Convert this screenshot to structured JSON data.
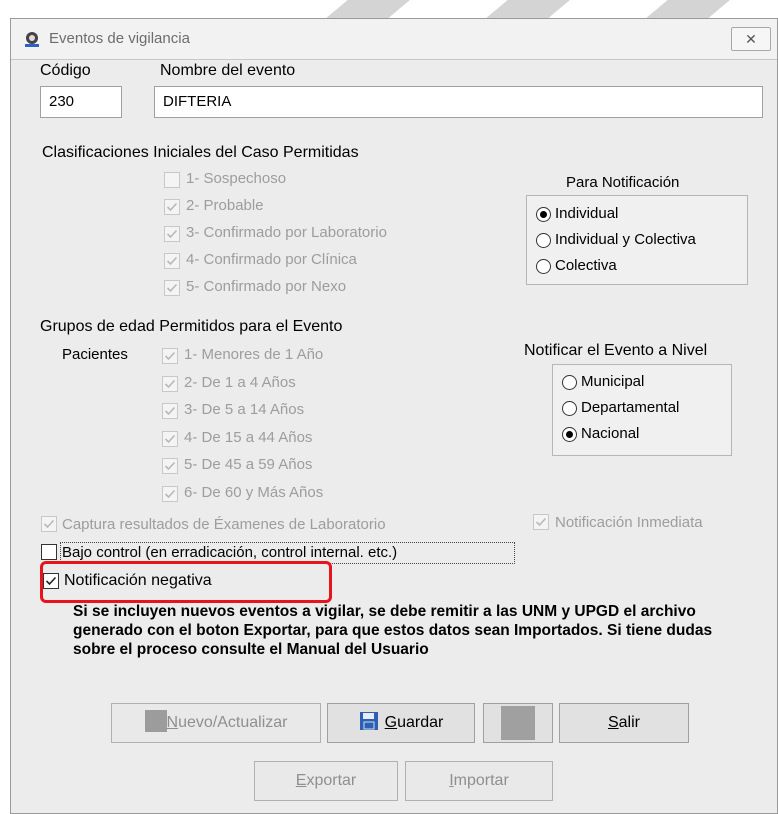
{
  "window": {
    "title": "Eventos de vigilancia",
    "close": "✕"
  },
  "codigo": {
    "label": "Código",
    "value": "230"
  },
  "nombre": {
    "label": "Nombre del evento",
    "value": "DIFTERIA"
  },
  "clasificaciones": {
    "heading": "Clasificaciones Iniciales del Caso Permitidas",
    "items": [
      {
        "label": "1- Sospechoso",
        "checked": false
      },
      {
        "label": "2- Probable",
        "checked": true
      },
      {
        "label": "3- Confirmado por Laboratorio",
        "checked": true
      },
      {
        "label": "4- Confirmado por Clínica",
        "checked": true
      },
      {
        "label": "5- Confirmado por Nexo",
        "checked": true
      }
    ]
  },
  "notificacion": {
    "heading": "Para Notificación",
    "options": [
      {
        "label": "Individual",
        "selected": true
      },
      {
        "label": "Individual y Colectiva",
        "selected": false
      },
      {
        "label": "Colectiva",
        "selected": false
      }
    ]
  },
  "grupos": {
    "heading": "Grupos de edad Permitidos para el Evento",
    "pacientes_label": "Pacientes",
    "items": [
      {
        "label": "1- Menores de 1 Año",
        "checked": true
      },
      {
        "label": "2- De 1 a 4 Años",
        "checked": true
      },
      {
        "label": "3- De 5 a 14 Años",
        "checked": true
      },
      {
        "label": "4- De 15 a 44 Años",
        "checked": true
      },
      {
        "label": "5- De 45 a 59 Años",
        "checked": true
      },
      {
        "label": "6- De 60 y Más Años",
        "checked": true
      }
    ]
  },
  "nivel": {
    "heading": "Notificar el Evento a Nivel",
    "options": [
      {
        "label": "Municipal",
        "selected": false
      },
      {
        "label": "Departamental",
        "selected": false
      },
      {
        "label": "Nacional",
        "selected": true
      }
    ]
  },
  "checks": {
    "captura": "Captura resultados de Éxamenes de Laboratorio",
    "inmediata": "Notificación Inmediata",
    "bajo_control": "Bajo control (en erradicación, control internal. etc.)",
    "negativa": "Notificación negativa"
  },
  "info_text": "Si se incluyen nuevos eventos a vigilar, se debe remitir a las UNM y UPGD el archivo generado con el boton Exportar, para que estos datos sean Importados. Si tiene dudas sobre el proceso consulte el Manual del Usuario",
  "buttons": {
    "nuevo": {
      "label": "Nuevo/Actualizar",
      "mnemonic": "N",
      "rest": "uevo/Actualizar"
    },
    "guardar": {
      "label": "Guardar",
      "mnemonic": "G",
      "rest": "uardar"
    },
    "salir": {
      "label": "Salir",
      "mnemonic": "S",
      "rest": "alir"
    },
    "exportar": {
      "label": "Exportar",
      "mnemonic": "E",
      "rest": "xportar"
    },
    "importar": {
      "label": "Importar",
      "mnemonic": "I",
      "rest": "mportar"
    }
  }
}
